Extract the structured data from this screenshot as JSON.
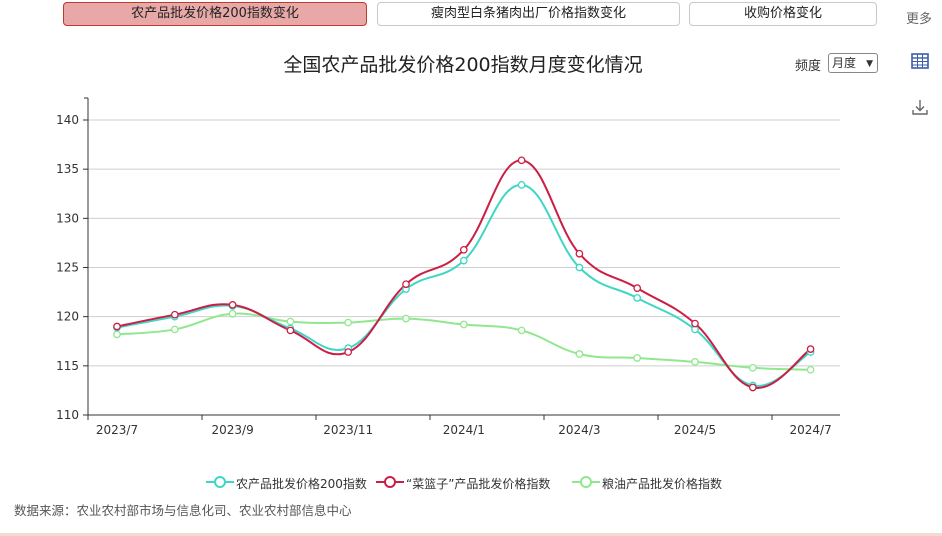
{
  "tabs": [
    {
      "label": "农产品批发价格200指数变化"
    },
    {
      "label": "瘦肉型白条猪肉出厂价格指数变化"
    },
    {
      "label": "收购价格变化"
    }
  ],
  "more_label": "更多",
  "toolbox": {
    "icons": [
      "table-icon",
      "download-icon"
    ]
  },
  "frequency": {
    "label": "频度",
    "selected": "月度"
  },
  "source": "数据来源：农业农村部市场与信息化司、农业农村部信息中心",
  "colors": {
    "series1": "#3fd6c6",
    "series2": "#cc1e44",
    "series3": "#90e88e"
  },
  "chart_data": {
    "type": "line",
    "title": "全国农产品批发价格200指数月度变化情况",
    "x": [
      "2023/7",
      "2023/8",
      "2023/9",
      "2023/10",
      "2023/11",
      "2023/12",
      "2024/1",
      "2024/2",
      "2024/3",
      "2024/4",
      "2024/5",
      "2024/6",
      "2024/7"
    ],
    "x_tick_labels": [
      "2023/7",
      "2023/9",
      "2023/11",
      "2024/1",
      "2024/3",
      "2024/5",
      "2024/7"
    ],
    "ylim": [
      110,
      140
    ],
    "y_ticks": [
      110,
      115,
      120,
      125,
      130,
      135,
      140
    ],
    "grid": true,
    "legend_position": "bottom",
    "smooth": true,
    "series": [
      {
        "name": "农产品批发价格200指数",
        "values": [
          118.9,
          120.0,
          121.1,
          118.8,
          116.8,
          122.8,
          125.7,
          133.4,
          125.0,
          121.9,
          118.7,
          113.0,
          116.4
        ]
      },
      {
        "name": "“菜篮子”产品批发价格指数",
        "values": [
          119.0,
          120.2,
          121.2,
          118.6,
          116.4,
          123.3,
          126.8,
          135.9,
          126.4,
          122.9,
          119.3,
          112.8,
          116.7
        ]
      },
      {
        "name": "粮油产品批发价格指数",
        "values": [
          118.2,
          118.7,
          120.3,
          119.5,
          119.4,
          119.8,
          119.2,
          118.6,
          116.2,
          115.8,
          115.4,
          114.8,
          114.6
        ]
      }
    ]
  }
}
